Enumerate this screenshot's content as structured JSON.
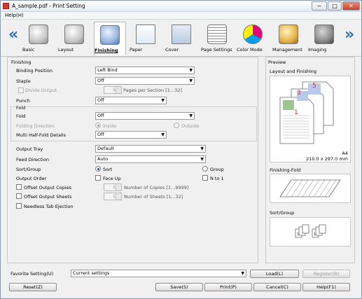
{
  "window": {
    "title": "A_sample.pdf - Print Setting",
    "min_label": "−",
    "max_label": "□",
    "close_label": "✕"
  },
  "menu": {
    "help": "Help(H)"
  },
  "toolbar": {
    "tabs": [
      {
        "label": "Basic",
        "icon": "basic-icon"
      },
      {
        "label": "Layout",
        "icon": "layout-icon"
      },
      {
        "label": "Finishing",
        "icon": "finishing-icon"
      },
      {
        "label": "Paper",
        "icon": "paper-icon"
      },
      {
        "label": "Cover",
        "icon": "cover-icon"
      },
      {
        "label": "Page Settings",
        "icon": "page-settings-icon"
      },
      {
        "label": "Color Mode",
        "icon": "color-mode-icon"
      },
      {
        "label": "Management",
        "icon": "management-icon"
      },
      {
        "label": "Imaging",
        "icon": "imaging-icon"
      }
    ],
    "left_arrow": "«",
    "right_arrow": "»",
    "active_tab": "Finishing"
  },
  "finishing": {
    "section_label": "Finishing",
    "binding_position": {
      "label": "Binding Position",
      "value": "Left Bind"
    },
    "staple": {
      "label": "Staple",
      "value": "Off"
    },
    "divide_output": {
      "label": "Divide Output",
      "value": "1",
      "range": "Pages per Section [1...32]"
    },
    "punch": {
      "label": "Punch",
      "value": "Off"
    },
    "fold_section": "Fold",
    "fold": {
      "label": "Fold",
      "value": "Off"
    },
    "folding_direction": {
      "label": "Folding Direction",
      "inside": "Inside",
      "outside": "Outside"
    },
    "multi_half_fold": {
      "label": "Multi Half-Fold Details",
      "value": "Off"
    },
    "output_tray": {
      "label": "Output Tray",
      "value": "Default"
    },
    "feed_direction": {
      "label": "Feed Direction",
      "value": "Auto"
    },
    "sort_group": {
      "label": "Sort/Group",
      "sort": "Sort",
      "group": "Group"
    },
    "output_order": {
      "label": "Output Order",
      "face_up": "Face Up",
      "n_to_1": "N to 1"
    },
    "offset_copies": {
      "label": "Offset Output Copies",
      "value": "1",
      "range": "Number of Copies [1...9999]"
    },
    "offset_sheets": {
      "label": "Offset Output Sheets",
      "value": "1",
      "range": "Number of Sheets [1...32]"
    },
    "needless_tab": {
      "label": "Needless Tab Ejection"
    }
  },
  "preview": {
    "title": "Preview",
    "layout_finishing": "Layout and Finishing",
    "paper_size": "A4",
    "paper_dims": "210.0 x 297.0 mm",
    "finishing_fold": "Finishing-Fold",
    "sort_group": "Sort/Group",
    "page_numbers": [
      "1",
      "3",
      "5"
    ]
  },
  "favorite": {
    "label": "Favorite Setting(U)",
    "value": "Current settings",
    "load": "Load(L)",
    "register": "Register(R)"
  },
  "buttons": {
    "reset": "Reset(Z)",
    "save": "Save(S)",
    "print": "Print(P)",
    "cancel": "Cancel(C)",
    "help": "Help(F1)"
  }
}
